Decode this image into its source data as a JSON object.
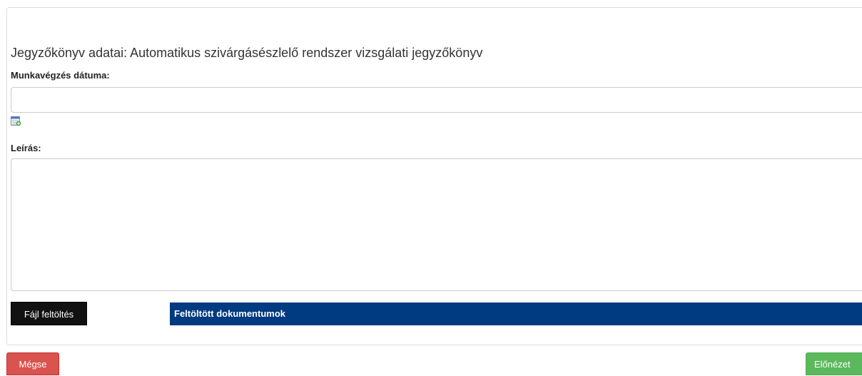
{
  "form": {
    "title": "Jegyzőkönyv adatai: Automatikus szivárgásészlelő rendszer vizsgálati jegyzőkönyv",
    "date_label": "Munkavégzés dátuma:",
    "date_value": "",
    "description_label": "Leírás:",
    "description_value": "",
    "upload_button": "Fájl feltöltés",
    "uploaded_docs_header": "Feltöltött dokumentumok"
  },
  "footer": {
    "cancel_button": "Mégse",
    "preview_button": "Előnézet"
  },
  "icons": {
    "date_picker": "calendar-icon"
  },
  "colors": {
    "docs_header_bg": "#003a80",
    "cancel_bg": "#d9534f",
    "preview_bg": "#5cb85c",
    "upload_bg": "#111111"
  }
}
